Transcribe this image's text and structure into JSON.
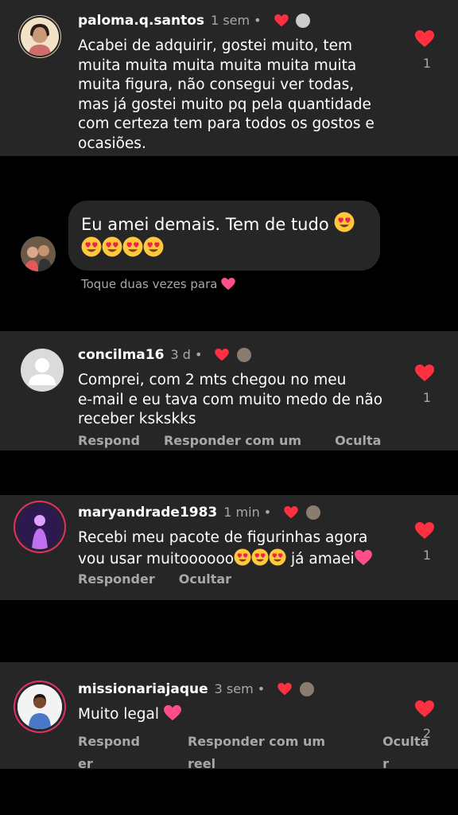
{
  "colors": {
    "background": "#000000",
    "card": "#262626",
    "like": "#ff3040",
    "muted": "#a8a8a8",
    "ring": "#e1306c"
  },
  "comments": [
    {
      "username": "paloma.q.santos",
      "time": "1 sem",
      "dot": "•",
      "text": [
        "Acabei de adquirir, gostei muito, tem",
        "muita muita muita muita muita muita",
        "muita figura, não consegui ver todas,",
        "mas já gostei muito pq pela quantidade",
        "com certeza tem para todos os gostos e",
        "ocasiões."
      ],
      "likes": "1"
    },
    {
      "username": "concilma16",
      "time": "3 d",
      "dot": "•",
      "text": [
        "Comprei, com 2 mts chegou no meu",
        "e-mail  e eu tava com muito medo de não",
        "receber kskskks"
      ],
      "actions": [
        "Respond",
        "Responder com um",
        "Oculta"
      ],
      "likes": "1"
    },
    {
      "username": "maryandrade1983",
      "time": "1 min",
      "dot": "•",
      "text": [
        "Recebi meu pacote de figurinhas agora",
        "vou usar muitoooooo"
      ],
      "text_tail": "já amaei",
      "actions": [
        "Responder",
        "Ocultar"
      ],
      "likes": "1"
    },
    {
      "username": "missionariajaque",
      "time": "3 sem",
      "dot": "•",
      "text": [
        "Muito legal"
      ],
      "actions": [
        "Respond",
        "Responder com um",
        "Oculta"
      ],
      "actions_wrap": [
        "er",
        "reel",
        "r"
      ],
      "likes": "2"
    }
  ],
  "message": {
    "line1": "Eu amei demais. Tem de tudo",
    "hint": "Toque duas vezes para"
  },
  "icons": [
    "heart-icon",
    "smiling-face-with-heart-eyes-emoji",
    "pink-heart-emoji"
  ]
}
